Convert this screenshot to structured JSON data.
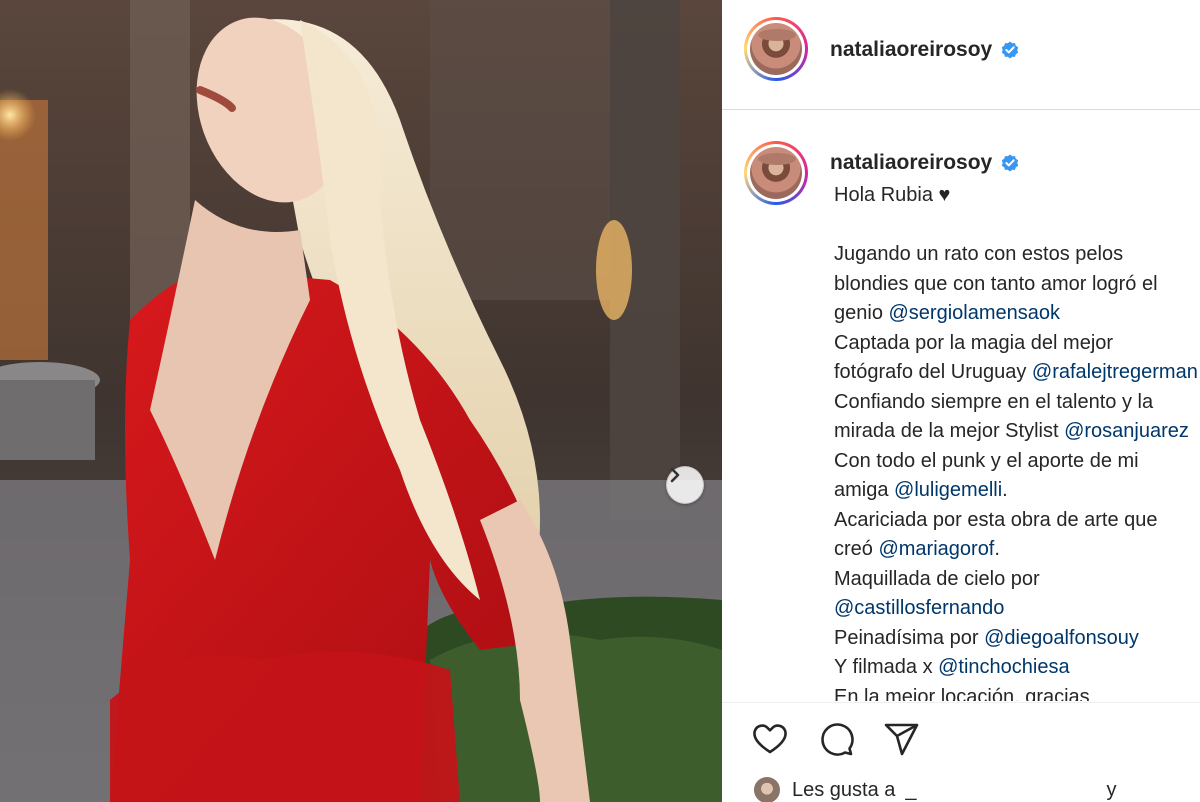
{
  "post": {
    "username": "nataliaoreirosoy",
    "verified": true,
    "photo_alt": "Woman with long wavy blonde hair in a red blazer dress, eyes closed, head tilted back, in front of stone columns and hedges",
    "next_icon": "chevron-right-icon"
  },
  "caption": {
    "username": "nataliaoreirosoy",
    "heading": "Hola Rubia ♥",
    "lines": [
      [
        {
          "t": "Jugando un rato con estos pelos",
          "m": false
        }
      ],
      [
        {
          "t": "blondies que con tanto amor logró el",
          "m": false
        }
      ],
      [
        {
          "t": "genio ",
          "m": false
        },
        {
          "t": "@sergiolamensaok",
          "m": true
        }
      ],
      [
        {
          "t": "Captada por la magia del mejor",
          "m": false
        }
      ],
      [
        {
          "t": "fotógrafo del Uruguay ",
          "m": false
        },
        {
          "t": "@rafalejtregerman",
          "m": true
        }
      ],
      [
        {
          "t": "Confiando siempre en el talento y la",
          "m": false
        }
      ],
      [
        {
          "t": "mirada de la mejor Stylist ",
          "m": false
        },
        {
          "t": "@rosanjuarez",
          "m": true
        }
      ],
      [
        {
          "t": "Con todo el punk y el aporte de mi",
          "m": false
        }
      ],
      [
        {
          "t": "amiga ",
          "m": false
        },
        {
          "t": "@luligemelli",
          "m": true
        },
        {
          "t": ".",
          "m": false
        }
      ],
      [
        {
          "t": "Acariciada por esta obra de arte que",
          "m": false
        }
      ],
      [
        {
          "t": "creó ",
          "m": false
        },
        {
          "t": "@mariagorof",
          "m": true
        },
        {
          "t": ".",
          "m": false
        }
      ],
      [
        {
          "t": "Maquillada de cielo por",
          "m": false
        }
      ],
      [
        {
          "t": "@castillosfernando",
          "m": true
        }
      ],
      [
        {
          "t": "Peinadísima por ",
          "m": false
        },
        {
          "t": "@diegoalfonsouy",
          "m": true
        }
      ],
      [
        {
          "t": "Y filmada x ",
          "m": false
        },
        {
          "t": "@tinchochiesa",
          "m": true
        }
      ],
      [
        {
          "t": "En la mejor locación, gracias",
          "m": false
        }
      ]
    ]
  },
  "actions": {
    "like_icon": "heart-icon",
    "comment_icon": "comment-icon",
    "share_icon": "send-icon"
  },
  "likes": {
    "prefix": "Les gusta a",
    "name_blank": "_",
    "suffix": "y"
  },
  "colors": {
    "text": "#262626",
    "mention": "#00376b",
    "verified": "#3897f0",
    "border": "#dbdbdb"
  }
}
